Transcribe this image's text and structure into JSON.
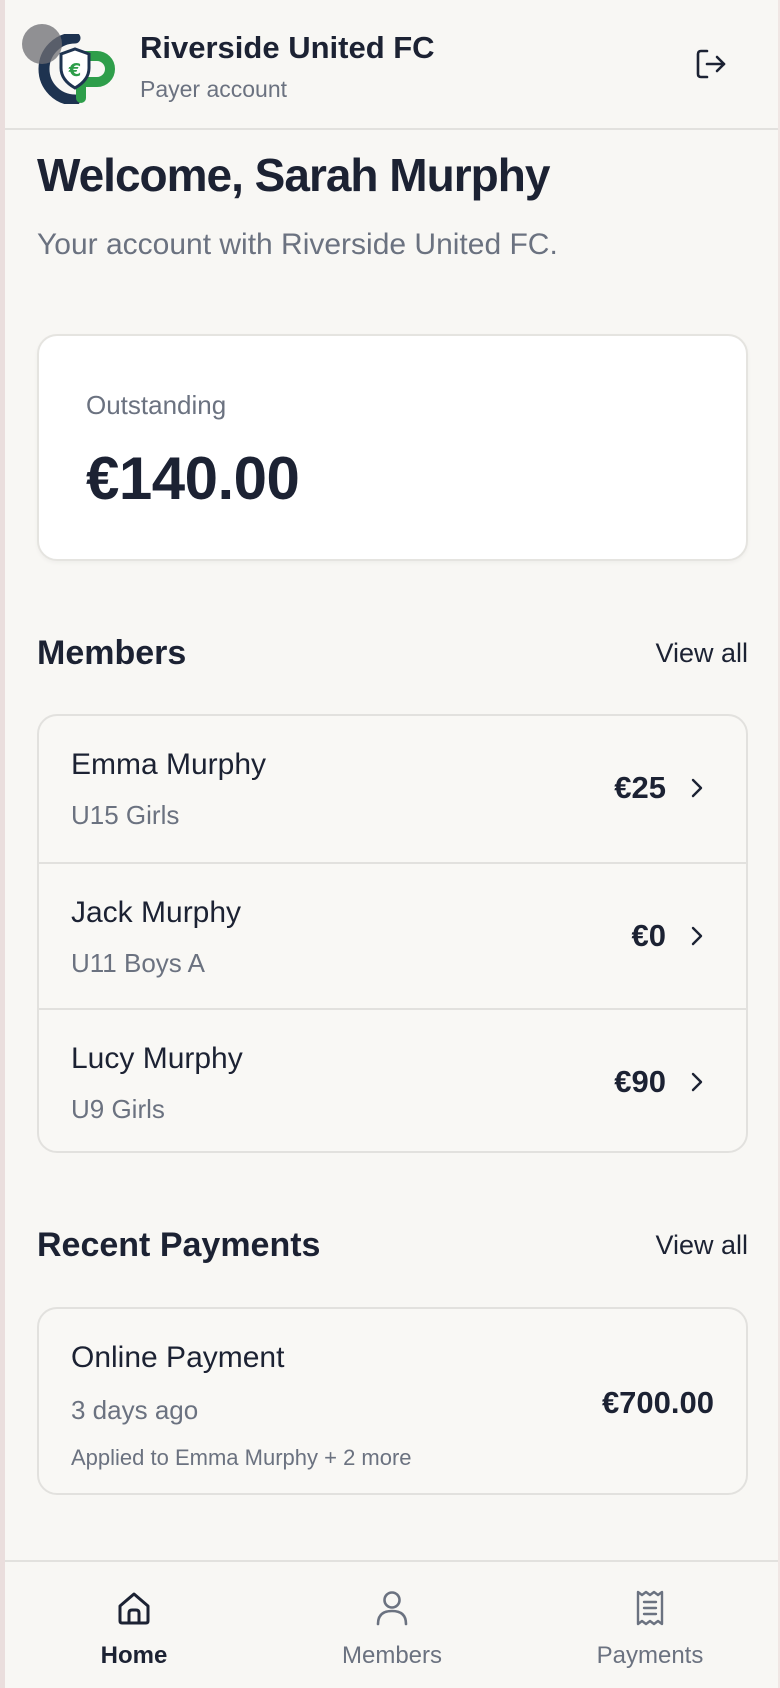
{
  "header": {
    "club_name": "Riverside United FC",
    "account_type": "Payer account",
    "logo_icon": "club-shield-logo",
    "logout_icon": "logout-icon"
  },
  "welcome": {
    "title": "Welcome, Sarah Murphy",
    "subtitle": "Your account with Riverside United FC."
  },
  "outstanding": {
    "label": "Outstanding",
    "amount": "€140.00"
  },
  "members": {
    "title": "Members",
    "view_all": "View all",
    "items": [
      {
        "name": "Emma Murphy",
        "team": "U15 Girls",
        "amount": "€25"
      },
      {
        "name": "Jack Murphy",
        "team": "U11 Boys A",
        "amount": "€0"
      },
      {
        "name": "Lucy Murphy",
        "team": "U9 Girls",
        "amount": "€90"
      }
    ]
  },
  "payments": {
    "title": "Recent Payments",
    "view_all": "View all",
    "items": [
      {
        "title": "Online Payment",
        "when": "3 days ago",
        "applied": "Applied to Emma Murphy + 2 more",
        "amount": "€700.00"
      }
    ]
  },
  "nav": {
    "items": [
      {
        "label": "Home",
        "icon": "home-icon",
        "active": true
      },
      {
        "label": "Members",
        "icon": "user-icon",
        "active": false
      },
      {
        "label": "Payments",
        "icon": "receipt-icon",
        "active": false
      }
    ]
  },
  "colors": {
    "text_primary": "#1c2233",
    "text_secondary": "#6b7280",
    "brand_green": "#2e9e4a",
    "brand_navy": "#1e3350",
    "background": "#f8f7f4"
  }
}
